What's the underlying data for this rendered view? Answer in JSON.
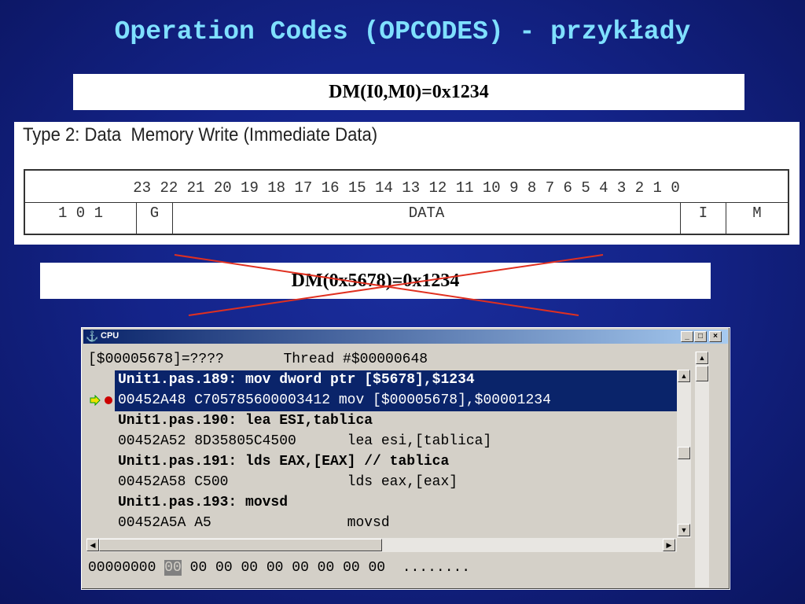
{
  "slide": {
    "title": "Operation Codes (OPCODES) - przykłady",
    "formula": "DM(I0,M0)=0x1234",
    "crossed_formula": "DM(0x5678)=0x1234"
  },
  "instruction_format": {
    "title": "Type 2: Data  Memory Write (Immediate Data)",
    "bit_numbers": "23 22 21 20 19 18 17 16 15 14 13 12 11 10 9 8 7 6 5 4 3 2 1 0",
    "fields": {
      "opcode": "1   0   1",
      "g": "G",
      "data": "DATA",
      "i": "I",
      "m": "M"
    }
  },
  "cpu_window": {
    "title": "CPU",
    "buttons": {
      "minimize": "_",
      "maximize": "□",
      "close": "×"
    },
    "status": "[$00005678]=????       Thread #$00000648",
    "code_lines": [
      {
        "text": "Unit1.pas.189: mov dword ptr [$5678],$1234",
        "bold": true
      },
      {
        "text": "00452A48 C70578560000341​2 mov [$00005678],$00001234",
        "bold": false
      },
      {
        "text": "Unit1.pas.190: lea ESI,tablica",
        "bold": true
      },
      {
        "text": "00452A52 8D35805C4500      lea esi,[tablica]",
        "bold": false
      },
      {
        "text": "Unit1.pas.191: lds EAX,[EAX] // tablica",
        "bold": true
      },
      {
        "text": "00452A58 C500              lds eax,[eax]",
        "bold": false
      },
      {
        "text": "Unit1.pas.193: movsd",
        "bold": true
      },
      {
        "text": "00452A5A A5                movsd",
        "bold": false
      }
    ],
    "hex_address": "00000000",
    "hex_selected": "00",
    "hex_rest": " 00 00 00 00 00 00 00 00",
    "hex_ascii": "  ........",
    "colors": {
      "selection": "#0a246a",
      "breakpoint": "#cc0000",
      "exec_arrow": "#00a000"
    }
  }
}
